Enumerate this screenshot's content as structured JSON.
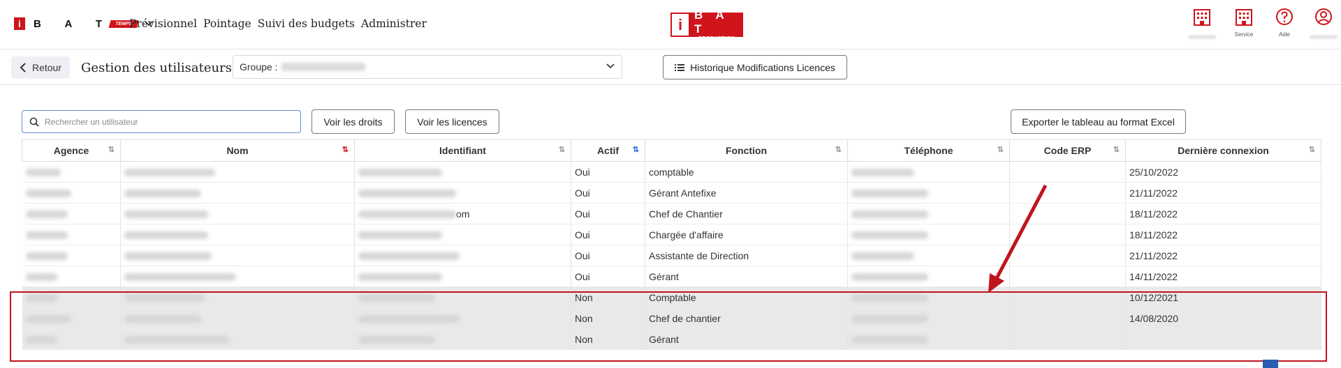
{
  "brand": {
    "letters": "B A T",
    "tag": "TEMPS",
    "i": "i"
  },
  "nav": [
    "Prévisionnel",
    "Pointage",
    "Suivi des budgets",
    "Administrer"
  ],
  "center_logo": {
    "i": "i",
    "letters": "B A T",
    "sub": "PRODUCTION"
  },
  "top_icons": [
    {
      "icon": "building-icon",
      "label": ""
    },
    {
      "icon": "building-icon",
      "label": "Service"
    },
    {
      "icon": "help-icon",
      "label": "Aide"
    },
    {
      "icon": "user-icon",
      "label": ""
    }
  ],
  "subheader": {
    "back_label": "Retour",
    "title": "Gestion des utilisateurs",
    "group_label": "Groupe :",
    "history_button": "Historique Modifications Licences"
  },
  "toolbar": {
    "search_placeholder": "Rechercher un utilisateur",
    "rights_button": "Voir les droits",
    "licences_button": "Voir les licences",
    "export_button": "Exporter le tableau au format Excel"
  },
  "table": {
    "columns": [
      "Agence",
      "Nom",
      "Identifiant",
      "Actif",
      "Fonction",
      "Téléphone",
      "Code ERP",
      "Dernière connexion"
    ],
    "rows": [
      {
        "actif": "Oui",
        "fonction": "comptable",
        "derniere": "25/10/2022",
        "id_suffix": "",
        "inactive": false
      },
      {
        "actif": "Oui",
        "fonction": "Gérant Antefixe",
        "derniere": "21/11/2022",
        "id_suffix": "",
        "inactive": false
      },
      {
        "actif": "Oui",
        "fonction": "Chef de Chantier",
        "derniere": "18/11/2022",
        "id_suffix": "om",
        "inactive": false
      },
      {
        "actif": "Oui",
        "fonction": "Chargée d'affaire",
        "derniere": "18/11/2022",
        "id_suffix": "",
        "inactive": false
      },
      {
        "actif": "Oui",
        "fonction": "Assistante de Direction",
        "derniere": "21/11/2022",
        "id_suffix": "",
        "inactive": false
      },
      {
        "actif": "Oui",
        "fonction": "Gérant",
        "derniere": "14/11/2022",
        "id_suffix": "",
        "inactive": false
      },
      {
        "actif": "Non",
        "fonction": "Comptable",
        "derniere": "10/12/2021",
        "id_suffix": "",
        "inactive": true
      },
      {
        "actif": "Non",
        "fonction": "Chef de chantier",
        "derniere": "14/08/2020",
        "id_suffix": "",
        "inactive": true
      },
      {
        "actif": "Non",
        "fonction": "Gérant",
        "derniere": "",
        "id_suffix": "",
        "inactive": true
      }
    ]
  },
  "colors": {
    "brand_red": "#d0141c",
    "highlight_red": "#c0141c",
    "search_border": "#5b8fd6",
    "sort_blue": "#2a6fd6"
  }
}
